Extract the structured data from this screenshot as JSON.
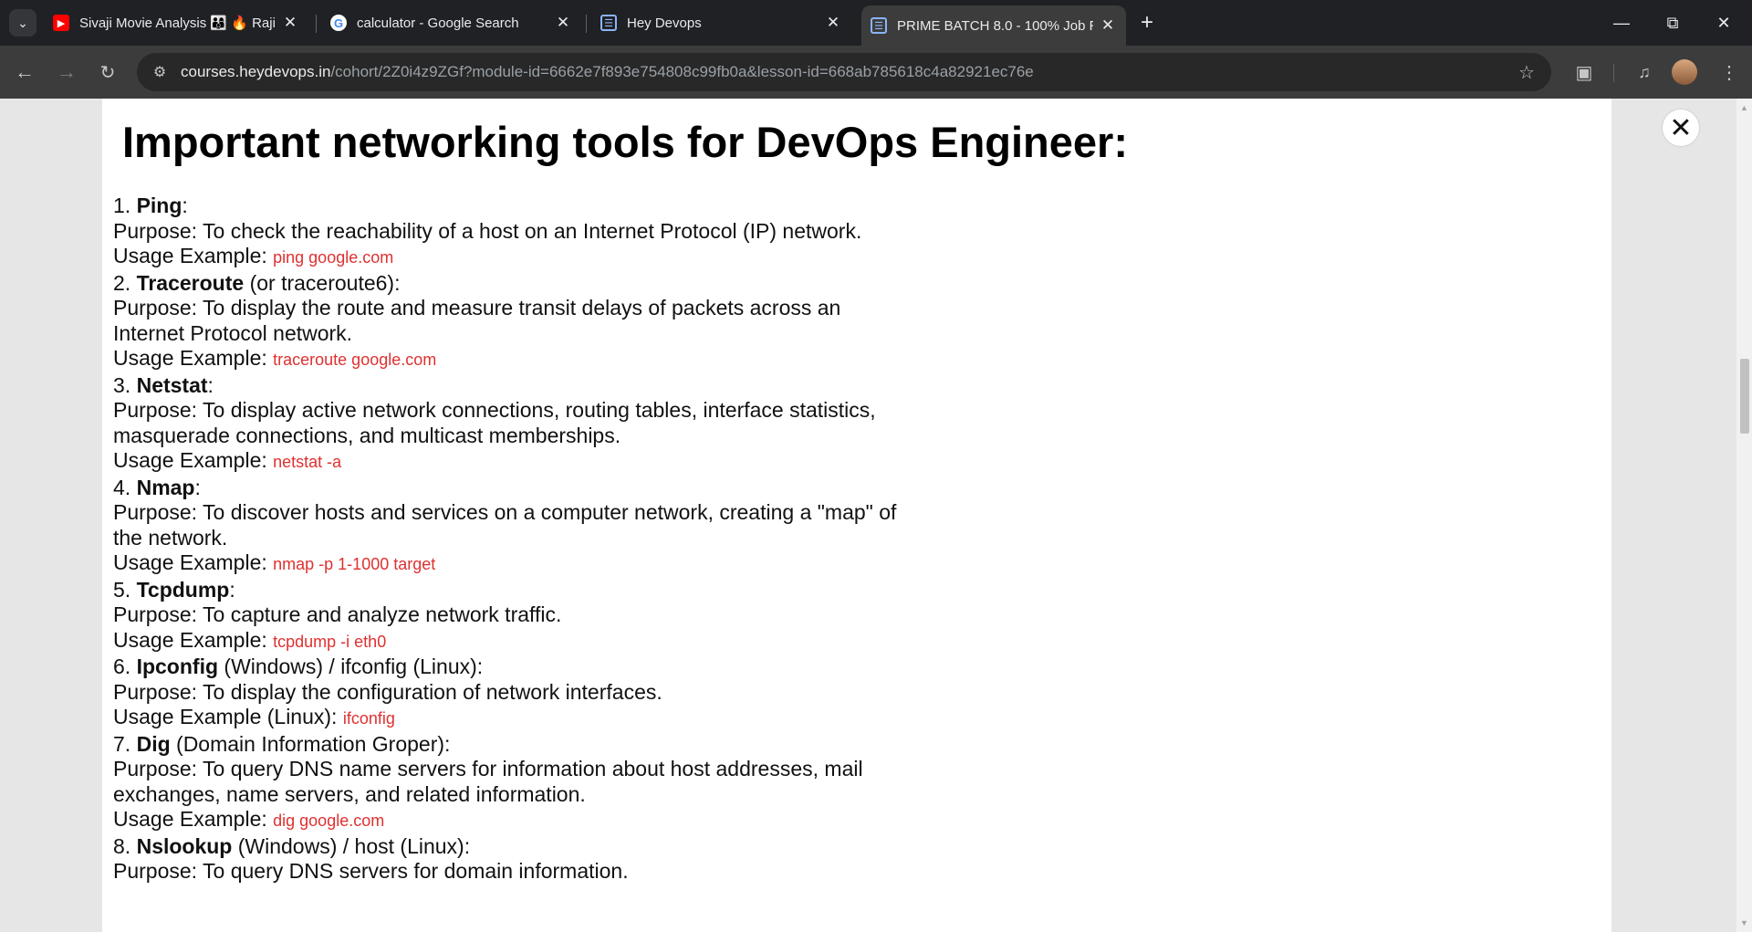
{
  "browser": {
    "tabs": [
      {
        "title": "Sivaji Movie Analysis 👨‍👩‍👦 🔥 Raji",
        "favicon": "youtube-icon",
        "color": "#ff0000"
      },
      {
        "title": "calculator - Google Search",
        "favicon": "google-icon",
        "color": "#ffffff"
      },
      {
        "title": "Hey Devops",
        "favicon": "heydevops-icon",
        "color": "#e8eaed"
      },
      {
        "title": "PRIME BATCH 8.0 - 100% Job R",
        "favicon": "heydevops-icon",
        "color": "#e8eaed",
        "active": true
      }
    ],
    "url_host": "courses.heydevops.in",
    "url_path": "/cohort/2Z0i4z9ZGf?module-id=6662e7f893e754808c99fb0a&lesson-id=668ab785618c4a82921ec76e"
  },
  "page": {
    "title": "Important networking tools for DevOps Engineer:",
    "items": [
      {
        "num": "1.",
        "name": "Ping",
        "suffix": ":",
        "purpose": "Purpose: To check the reachability of a host on an Internet Protocol (IP) network.",
        "usage_label": "Usage Example: ",
        "usage_code": "ping google.com"
      },
      {
        "num": "2.",
        "name": "Traceroute",
        "suffix": " (or traceroute6):",
        "purpose": "Purpose: To display the route and measure transit delays of packets across an Internet Protocol network.",
        "usage_label": "Usage Example: ",
        "usage_code": "traceroute google.com"
      },
      {
        "num": "3.",
        "name": "Netstat",
        "suffix": ":",
        "purpose": "Purpose: To display active network connections, routing tables, interface statistics, masquerade connections, and multicast memberships.",
        "usage_label": "Usage Example: ",
        "usage_code": "netstat -a"
      },
      {
        "num": "4.",
        "name": "Nmap",
        "suffix": ":",
        "purpose": "Purpose: To discover hosts and services on a computer network, creating a \"map\" of the network.",
        "usage_label": "Usage Example: ",
        "usage_code": "nmap -p 1-1000 target"
      },
      {
        "num": "5.",
        "name": "Tcpdump",
        "suffix": ":",
        "purpose": "Purpose: To capture and analyze network traffic.",
        "usage_label": "Usage Example: ",
        "usage_code": "tcpdump -i eth0"
      },
      {
        "num": "6.",
        "name": "Ipconfig",
        "suffix": " (Windows) / ifconfig (Linux):",
        "purpose": "Purpose: To display the configuration of network interfaces.",
        "usage_label": "Usage Example (Linux): ",
        "usage_code": "ifconfig"
      },
      {
        "num": "7.",
        "name": "Dig",
        "suffix": " (Domain Information Groper):",
        "purpose": "Purpose: To query DNS name servers for information about host addresses, mail exchanges, name servers, and related information.",
        "usage_label": "Usage Example: ",
        "usage_code": "dig google.com"
      },
      {
        "num": "8.",
        "name": "Nslookup",
        "suffix": " (Windows) / host (Linux):",
        "purpose": "Purpose: To query DNS servers for domain information.",
        "usage_label": "",
        "usage_code": ""
      }
    ]
  }
}
